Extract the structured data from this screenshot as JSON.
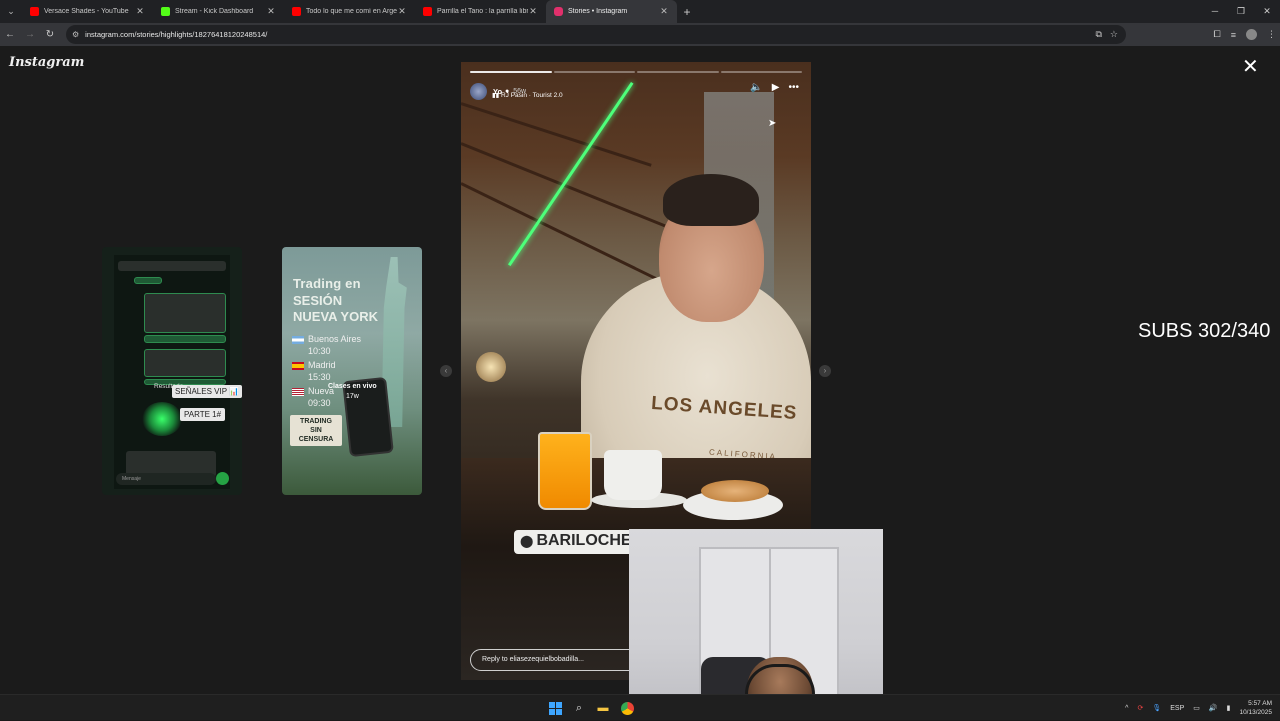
{
  "browser": {
    "tabs": [
      {
        "title": "Versace Shades - YouTube",
        "favicon_color": "#ff0000",
        "active": false
      },
      {
        "title": "Stream - Kick Dashboard",
        "favicon_color": "#53fc18",
        "active": false
      },
      {
        "title": "Todo lo que me comí en Argen",
        "favicon_color": "#ff0000",
        "active": false
      },
      {
        "title": "Parrilla el Tano : la parrilla libre",
        "favicon_color": "#ff0000",
        "active": false
      },
      {
        "title": "Stories • Instagram",
        "favicon_color": "#e1306c",
        "active": true
      }
    ],
    "url": "instagram.com/stories/highlights/18276418120248514/"
  },
  "instagram": {
    "logo": "Instagram",
    "story": {
      "username": "Yo",
      "time": "56w",
      "music": "RJ Pasin · Tourist 2.0",
      "location_tag": "BARILOCHE, A",
      "hoodie_text": "LOS ANGELES",
      "hoodie_sub": "CALIFORNIA",
      "reply_placeholder": "Reply to eliasezequielbobadilla...",
      "progress_segments": 4,
      "progress_done": 1
    },
    "thumb1": {
      "label_results": "Resultado",
      "vip_label": "SEÑALES VIP 📊",
      "part_label": "PARTE 1#",
      "message_placeholder": "Mensaje"
    },
    "thumb2": {
      "title_line1": "Trading en",
      "title_line2": "SESIÓN",
      "title_line3": "NUEVA YORK",
      "rows": [
        {
          "city": "Buenos Aires",
          "time": "10:30"
        },
        {
          "city": "Madrid",
          "time": "15:30"
        },
        {
          "city": "Nueva",
          "time": "09:30"
        }
      ],
      "live_label": "Clases en vivo",
      "live_time": "17w",
      "badge_line1": "TRADING",
      "badge_line2": "SIN CENSURA"
    }
  },
  "overlay": {
    "subs_counter": "SUBS 302/340"
  },
  "taskbar": {
    "lang": "ESP",
    "time": "5:57 AM",
    "date": "10/13/2025"
  }
}
